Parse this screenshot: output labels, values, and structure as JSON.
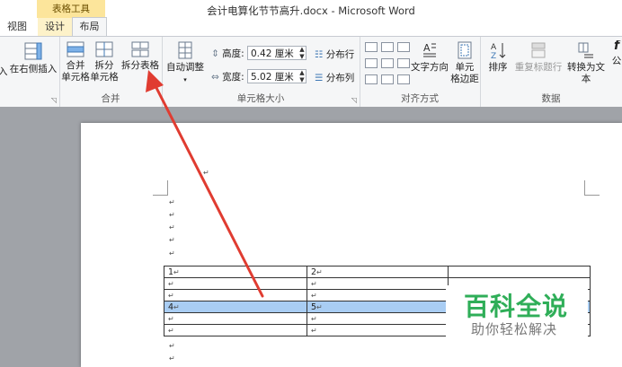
{
  "window": {
    "title": "会计电算化节节高升.docx - Microsoft Word"
  },
  "contextual_group": "表格工具",
  "tabs": [
    {
      "label": "视图"
    },
    {
      "label": "设计"
    },
    {
      "label": "布局"
    }
  ],
  "ribbon": {
    "rows_columns": {
      "insert_left_partial": "入",
      "insert_right": "在右侧插入"
    },
    "merge": {
      "label": "合并",
      "merge_cells": [
        "合并",
        "单元格"
      ],
      "split_cells": [
        "拆分",
        "单元格"
      ],
      "split_table": "拆分表格"
    },
    "cell_size": {
      "label": "单元格大小",
      "autofit": "自动调整",
      "height_label": "高度:",
      "height_value": "0.42 厘米",
      "width_label": "宽度:",
      "width_value": "5.02 厘米",
      "distribute_rows": "分布行",
      "distribute_cols": "分布列"
    },
    "alignment": {
      "label": "对齐方式",
      "text_direction": "文字方向",
      "cell_margins": [
        "单元",
        "格边距"
      ]
    },
    "data": {
      "label": "数据",
      "sort": "排序",
      "repeat_header": "重复标题行",
      "convert_to_text": "转换为文本",
      "formula_partial": "公"
    }
  },
  "document": {
    "paragraph_mark": "↵",
    "table": [
      [
        "1",
        "2",
        ""
      ],
      [
        "",
        "",
        ""
      ],
      [
        "",
        "",
        ""
      ],
      [
        "4",
        "5",
        ""
      ],
      [
        "",
        "",
        ""
      ],
      [
        "",
        "",
        ""
      ]
    ],
    "selected_row": 3
  },
  "watermark": {
    "title": "百科全说",
    "subtitle": "助你轻松解决"
  },
  "colors": {
    "context_tab": "#fce59b",
    "selection": "#a9cdf3",
    "arrow": "#e03c31",
    "watermark": "#2fae58"
  }
}
